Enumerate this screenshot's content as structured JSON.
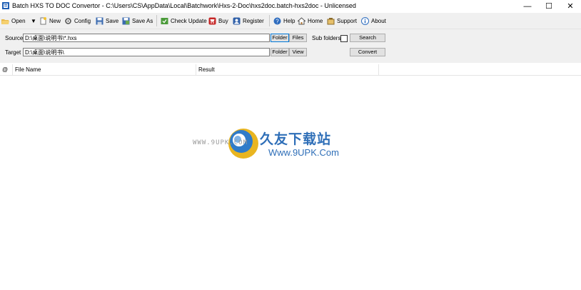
{
  "window": {
    "title": "Batch HXS TO DOC Convertor - C:\\Users\\CS\\AppData\\Local\\Batchwork\\Hxs-2-Doc\\hxs2doc.batch-hxs2doc - Unlicensed",
    "minimize": "—",
    "maximize": "☐",
    "close": "✕"
  },
  "toolbar": {
    "open": "Open",
    "open_dropdown": "▼",
    "new": "New",
    "config": "Config",
    "save": "Save",
    "save_as": "Save As",
    "check_update": "Check Update",
    "buy": "Buy",
    "register": "Register",
    "help": "Help",
    "home": "Home",
    "support": "Support",
    "about": "About"
  },
  "form": {
    "source_label": "Source",
    "source_value": "D:\\桌面\\说明书\\*.hxs",
    "target_label": "Target",
    "target_value": "D:\\桌面\\说明书\\",
    "folder": "Folder",
    "files": "Files",
    "view": "View",
    "subfolders_label": "Sub folders",
    "subfolders_checked": false,
    "search": "Search",
    "convert": "Convert"
  },
  "list": {
    "columns": [
      "@",
      "File Name",
      "Result"
    ]
  },
  "watermark": {
    "cn": "久友下载站",
    "url_left": "WWW.9UPK.COM",
    "url_right": "Www.9UPK.Com"
  }
}
